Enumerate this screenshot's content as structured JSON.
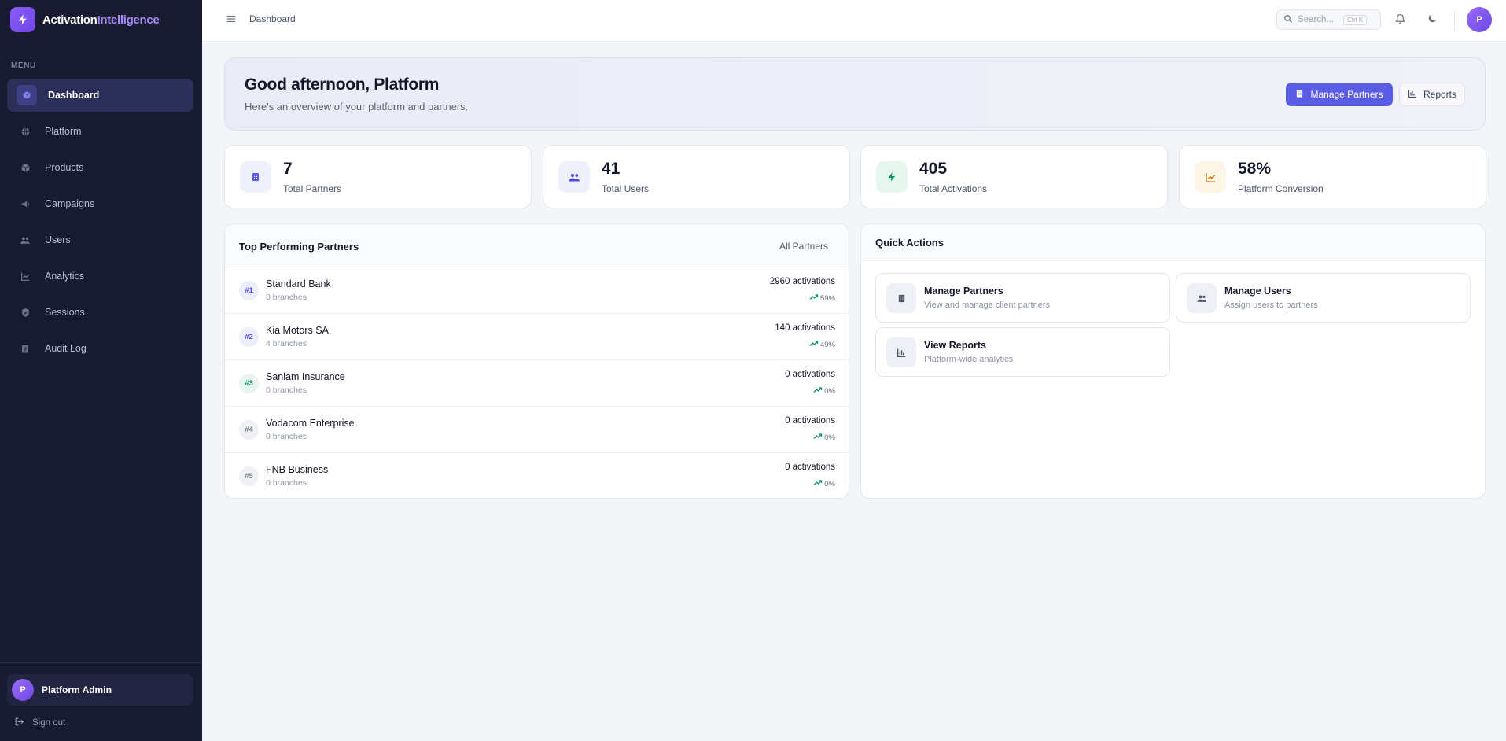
{
  "brand": {
    "name_part1": "Activation",
    "name_part2": "Intelligence",
    "logo_icon": "lightning-icon"
  },
  "sidebar": {
    "menu_label": "MENU",
    "items": [
      {
        "label": "Dashboard",
        "icon": "dashboard-icon",
        "active": true
      },
      {
        "label": "Platform",
        "icon": "globe-icon"
      },
      {
        "label": "Products",
        "icon": "box-icon"
      },
      {
        "label": "Campaigns",
        "icon": "megaphone-icon"
      },
      {
        "label": "Users",
        "icon": "users-icon"
      },
      {
        "label": "Analytics",
        "icon": "chart-line-icon"
      },
      {
        "label": "Sessions",
        "icon": "shield-icon"
      },
      {
        "label": "Audit Log",
        "icon": "clipboard-icon"
      }
    ],
    "user": {
      "initial": "P",
      "name": "Platform Admin"
    },
    "signout_label": "Sign out"
  },
  "topbar": {
    "breadcrumb": "Dashboard",
    "search_placeholder": "Search...",
    "search_shortcut": "Ctrl K",
    "avatar_initial": "P"
  },
  "hero": {
    "title": "Good afternoon, Platform",
    "subtitle": "Here's an overview of your platform and partners.",
    "primary_button": "Manage Partners",
    "secondary_button": "Reports"
  },
  "stats": [
    {
      "value": "7",
      "label": "Total Partners",
      "icon": "building-icon",
      "color": "#5b5ce6",
      "bg": "#eef0fb"
    },
    {
      "value": "41",
      "label": "Total Users",
      "icon": "users-icon",
      "color": "#4f46e5",
      "bg": "#eef0fb"
    },
    {
      "value": "405",
      "label": "Total Activations",
      "icon": "lightning-icon",
      "color": "#059669",
      "bg": "#e7f7ef"
    },
    {
      "value": "58%",
      "label": "Platform Conversion",
      "icon": "chart-line-icon",
      "color": "#d97706",
      "bg": "#fdf5e6"
    }
  ],
  "top_partners": {
    "title": "Top Performing Partners",
    "link": "All Partners",
    "rows": [
      {
        "rank": "#1",
        "name": "Standard Bank",
        "branches": "8 branches",
        "activations": "2960 activations",
        "trend": "59%",
        "rank_color": "#4f46e5",
        "rank_bg": "#eceefb"
      },
      {
        "rank": "#2",
        "name": "Kia Motors SA",
        "branches": "4 branches",
        "activations": "140 activations",
        "trend": "49%",
        "rank_color": "#4f46e5",
        "rank_bg": "#eceefb"
      },
      {
        "rank": "#3",
        "name": "Sanlam Insurance",
        "branches": "0 branches",
        "activations": "0 activations",
        "trend": "0%",
        "rank_color": "#059669",
        "rank_bg": "#e7f7ef"
      },
      {
        "rank": "#4",
        "name": "Vodacom Enterprise",
        "branches": "0 branches",
        "activations": "0 activations",
        "trend": "0%",
        "rank_color": "#7b8091",
        "rank_bg": "#f0f1f5"
      },
      {
        "rank": "#5",
        "name": "FNB Business",
        "branches": "0 branches",
        "activations": "0 activations",
        "trend": "0%",
        "rank_color": "#7b8091",
        "rank_bg": "#f0f1f5"
      }
    ]
  },
  "quick_actions": {
    "title": "Quick Actions",
    "items": [
      {
        "title": "Manage Partners",
        "subtitle": "View and manage client partners",
        "icon": "building-icon"
      },
      {
        "title": "Manage Users",
        "subtitle": "Assign users to partners",
        "icon": "users-icon"
      },
      {
        "title": "View Reports",
        "subtitle": "Platform-wide analytics",
        "icon": "chart-bar-icon"
      }
    ]
  },
  "colors": {
    "accent": "#5b5ce6",
    "sidebar_bg": "#181a30",
    "trend_up": "#059669"
  }
}
